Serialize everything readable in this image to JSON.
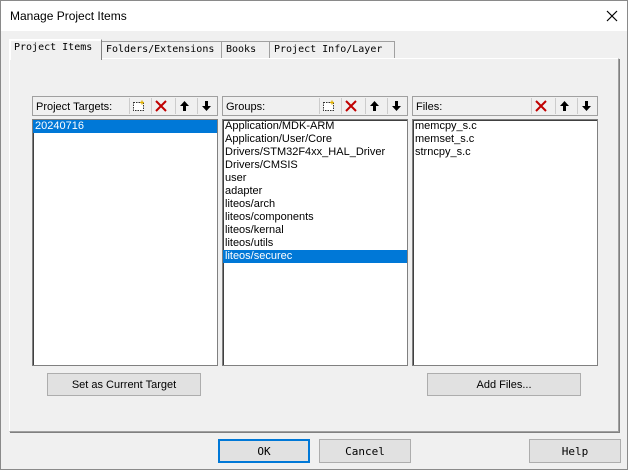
{
  "dialog": {
    "title": "Manage Project Items"
  },
  "tabs": [
    {
      "label": "Project Items"
    },
    {
      "label": "Folders/Extensions"
    },
    {
      "label": "Books"
    },
    {
      "label": "Project Info/Layer"
    }
  ],
  "targets": {
    "label": "Project Targets:",
    "items": [
      "20240716"
    ],
    "selected_index": 0,
    "set_current_label": "Set as Current Target"
  },
  "groups": {
    "label": "Groups:",
    "items": [
      "Application/MDK-ARM",
      "Application/User/Core",
      "Drivers/STM32F4xx_HAL_Driver",
      "Drivers/CMSIS",
      "user",
      "adapter",
      "liteos/arch",
      "liteos/components",
      "liteos/kernal",
      "liteos/utils",
      "liteos/securec"
    ],
    "selected_index": 10
  },
  "files": {
    "label": "Files:",
    "items": [
      "memcpy_s.c",
      "memset_s.c",
      "strncpy_s.c"
    ],
    "add_files_label": "Add Files..."
  },
  "footer": {
    "ok_label": "OK",
    "cancel_label": "Cancel",
    "help_label": "Help"
  },
  "colors": {
    "selection": "#0078d7",
    "delete_red": "#c00000",
    "new_yellow": "#f5d000"
  }
}
